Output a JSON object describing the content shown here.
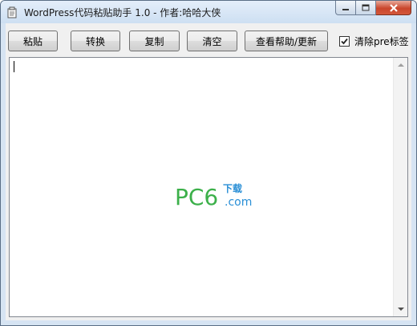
{
  "window": {
    "title": "WordPress代码粘贴助手 1.0  - 作者:哈哈大侠"
  },
  "toolbar": {
    "paste_label": "粘贴",
    "convert_label": "转换",
    "copy_label": "复制",
    "clear_label": "清空",
    "help_label": "查看帮助/更新",
    "strip_pre_label": "清除pre标签",
    "strip_pre_checked": true
  },
  "editor": {
    "content": ""
  },
  "watermark": {
    "brand": "PC6",
    "suffix": ".com",
    "tagline": "下载"
  },
  "icons": {
    "app": "app-icon",
    "minimize": "minimize-icon",
    "maximize": "maximize-icon",
    "close": "close-icon",
    "check": "check-icon",
    "scroll_up": "scroll-up-arrow-icon",
    "scroll_down": "scroll-down-arrow-icon"
  },
  "colors": {
    "watermark_green": "#3cb04a",
    "watermark_blue": "#2a8fd6"
  }
}
